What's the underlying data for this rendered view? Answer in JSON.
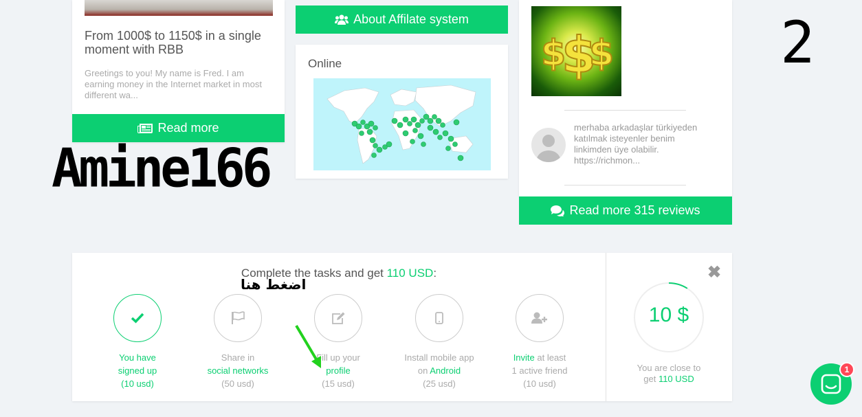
{
  "blog": {
    "title": "From 1000$ to 1150$ in a single moment with RBB",
    "excerpt": "Greetings to you! My name is Fred. I am earning money in the Internet market in most different wa...",
    "read_more_label": "Read more"
  },
  "overlay": {
    "username": "Amine166",
    "step_number": "2",
    "arabic_note": "اضغط هنا"
  },
  "affiliate": {
    "button_label": "About Affilate system"
  },
  "online": {
    "title": "Online"
  },
  "reviews": {
    "review_text": "merhaba arkadaşlar türkiyeden katılmak isteyenler benim linkimden üye olabilir. https://richmon...",
    "button_label": "Read more 315 reviews"
  },
  "tasks": {
    "title_prefix": "Complete the tasks and get ",
    "title_amount": "110 USD",
    "title_suffix": ":",
    "items": [
      {
        "line1": "You have",
        "line2": "signed up",
        "reward": "(10 usd)",
        "icon": "check-icon",
        "done": true
      },
      {
        "line1": "Share in",
        "line2": "social networks",
        "reward": "(50 usd)",
        "icon": "flag-icon",
        "done": false
      },
      {
        "line1": "Fill up your",
        "line2": "profile",
        "reward": "(15 usd)",
        "icon": "edit-icon",
        "done": false
      },
      {
        "line1": "Install mobile app",
        "line2_prefix": "on ",
        "line2": "Android",
        "reward": "(25 usd)",
        "icon": "mobile-icon",
        "done": false
      },
      {
        "line1_link": "Invite",
        "line1": " at least",
        "line2": "1 active friend",
        "reward": "(10 usd)",
        "icon": "user-plus-icon",
        "done": false
      }
    ],
    "progress_amount": "10 $",
    "progress_fraction": 0.09,
    "close_text_prefix": "You are close to",
    "close_text_get": "get ",
    "close_text_amount": "110 USD",
    "close_symbol": "✖"
  },
  "chat": {
    "badge_count": "1"
  },
  "colors": {
    "accent": "#0ccf72",
    "badge": "#ff4757"
  }
}
